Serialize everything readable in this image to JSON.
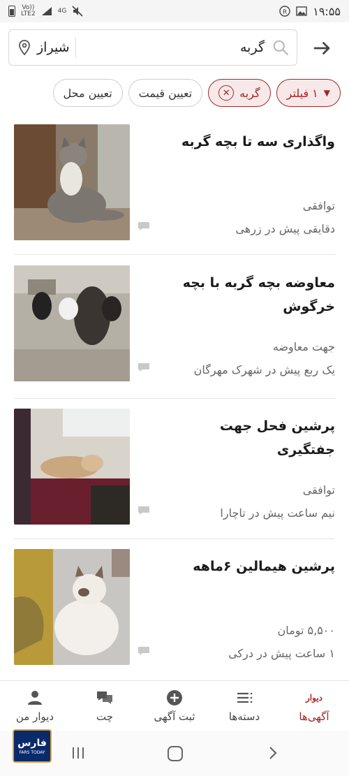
{
  "status_bar": {
    "time": "۱۹:۵۵",
    "network_top": "Vo))",
    "network_bottom": "LTE2",
    "signal_label": "4G"
  },
  "search": {
    "query": "گربه",
    "city": "شیراز"
  },
  "filters": [
    {
      "label": "۱ فیلتر",
      "active": true
    },
    {
      "label": "گربه",
      "active": true,
      "removable": true
    },
    {
      "label": "تعیین قیمت",
      "active": false
    },
    {
      "label": "تعیین محل",
      "active": false
    }
  ],
  "listings": [
    {
      "title": "واگذاری  سه تا بچه گربه",
      "price": "توافقی",
      "meta": "دقایقی پیش در زرهی"
    },
    {
      "title": "معاوضه بچه گربه با بچه خرگوش",
      "price": "جهت معاوضه",
      "meta": "یک ربع پیش در شهرک مهرگان"
    },
    {
      "title": "پرشین فحل جهت جفتگیری",
      "price": "توافقی",
      "meta": "نیم ساعت پیش در تاچارا"
    },
    {
      "title": "پرشین هیمالین ۶ماهه",
      "price": "۵,۵۰۰ تومان",
      "meta": "۱ ساعت پیش در درکی"
    }
  ],
  "bottom_nav": [
    {
      "label": "آگهی‌ها",
      "logo_text": "دیوار",
      "icon": "divar-logo",
      "active": true
    },
    {
      "label": "دسته‌ها",
      "icon": "categories-icon"
    },
    {
      "label": "ثبت آگهی",
      "icon": "add-circle-icon"
    },
    {
      "label": "چت",
      "icon": "chat-bubbles-icon"
    },
    {
      "label": "دیوار من",
      "icon": "person-icon"
    }
  ],
  "watermark": {
    "main": "فارس",
    "sub": "FARS TODAY"
  },
  "colors": {
    "accent": "#a62626",
    "accent_bg": "#f7e9e9",
    "text": "#222222",
    "muted": "#666666"
  }
}
